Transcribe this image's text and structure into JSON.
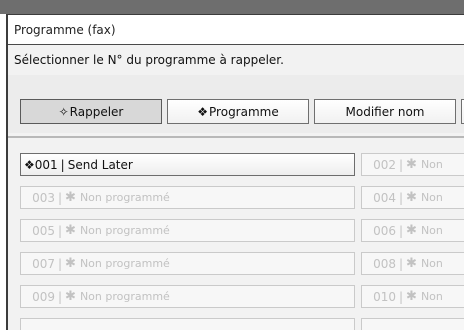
{
  "window": {
    "title": "Programme (fax)"
  },
  "instruction": "Sélectionner le N° du programme à rappeler.",
  "tabs": [
    {
      "label": "Rappeler",
      "glyph": "✧",
      "active": true
    },
    {
      "label": "Programme",
      "glyph": "❖",
      "active": false
    },
    {
      "label": "Modifier nom",
      "glyph": "",
      "active": false
    }
  ],
  "slots": [
    {
      "number": "001",
      "label": "Send Later",
      "filled": true,
      "glyph": "❖"
    },
    {
      "number": "002",
      "label": "Non",
      "filled": false
    },
    {
      "number": "003",
      "label": "Non programmé",
      "filled": false
    },
    {
      "number": "004",
      "label": "Non",
      "filled": false
    },
    {
      "number": "005",
      "label": "Non programmé",
      "filled": false
    },
    {
      "number": "006",
      "label": "Non",
      "filled": false
    },
    {
      "number": "007",
      "label": "Non programmé",
      "filled": false
    },
    {
      "number": "008",
      "label": "Non",
      "filled": false
    },
    {
      "number": "009",
      "label": "Non programmé",
      "filled": false
    },
    {
      "number": "010",
      "label": "Non",
      "filled": false
    }
  ],
  "empty_glyph": "✱",
  "colors": {
    "frame_border": "#3c3c3c",
    "active_tab": "#d8d8d8",
    "disabled_text": "#c2c2c2"
  }
}
